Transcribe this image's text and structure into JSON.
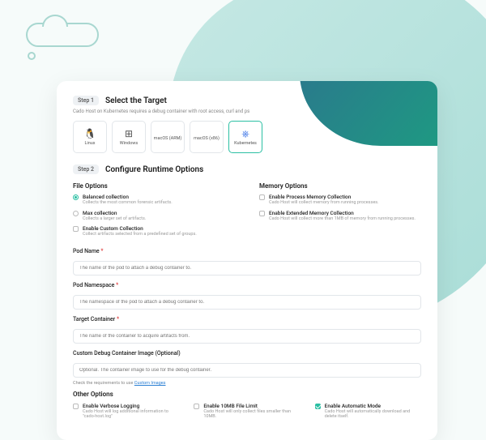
{
  "step1": {
    "chip": "Step 1",
    "title": "Select the Target",
    "subtitle": "Cado Host on Kubernetes requires a debug container with root access, curl and ps"
  },
  "targets": [
    {
      "name": "linux",
      "label": "Linux",
      "icon": "🐧"
    },
    {
      "name": "windows",
      "label": "Windows",
      "icon": "⊞"
    },
    {
      "name": "macos-arm",
      "label": "macOS (ARM)",
      "icon": ""
    },
    {
      "name": "macos-x86",
      "label": "macOS (x86)",
      "icon": ""
    },
    {
      "name": "kubernetes",
      "label": "Kubernetes",
      "icon": "⎈",
      "selected": true
    }
  ],
  "step2": {
    "chip": "Step 2",
    "title": "Configure Runtime Options"
  },
  "fileOptions": {
    "header": "File Options",
    "items": [
      {
        "label": "Balanced collection",
        "desc": "Collects the most common forensic artifacts.",
        "selected": true
      },
      {
        "label": "Max collection",
        "desc": "Collects a larger set of artifacts.",
        "selected": false
      },
      {
        "label": "Enable Custom Collection",
        "desc": "Collect artifacts selected from a predefined set of groups.",
        "selected": false,
        "type": "check"
      }
    ]
  },
  "memoryOptions": {
    "header": "Memory Options",
    "items": [
      {
        "label": "Enable Process Memory Collection",
        "desc": "Cado Host will collect memory from running processes."
      },
      {
        "label": "Enable Extended Memory Collection",
        "desc": "Cado Host will collect more than 1MB of memory from running processes."
      }
    ]
  },
  "fields": {
    "podName": {
      "label": "Pod Name",
      "required": "*",
      "placeholder": "The name of the pod to attach a debug container to."
    },
    "podNamespace": {
      "label": "Pod Namespace",
      "required": "*",
      "placeholder": "The namespace of the pod to attach a debug container to."
    },
    "targetContainer": {
      "label": "Target Container",
      "required": "*",
      "placeholder": "The name of the container to acquire artifacts from."
    },
    "customImage": {
      "label": "Custom Debug Container Image (Optional)",
      "placeholder": "Optional. The container image to use for the debug container."
    }
  },
  "customImageHint": {
    "prefix": "Check the requirements to use ",
    "link": "Custom Images"
  },
  "otherOptions": {
    "header": "Other Options",
    "items": [
      {
        "label": "Enable Verbose Logging",
        "desc": "Cado Host will log additional information to \"cado-host.log\"",
        "checked": false
      },
      {
        "label": "Enable 10MB File Limit",
        "desc": "Cado Host will only collect files smaller than 10MB.",
        "checked": false
      },
      {
        "label": "Enable Automatic Mode",
        "desc": "Cado Host will automatically download and delete itself.",
        "checked": true
      }
    ]
  }
}
